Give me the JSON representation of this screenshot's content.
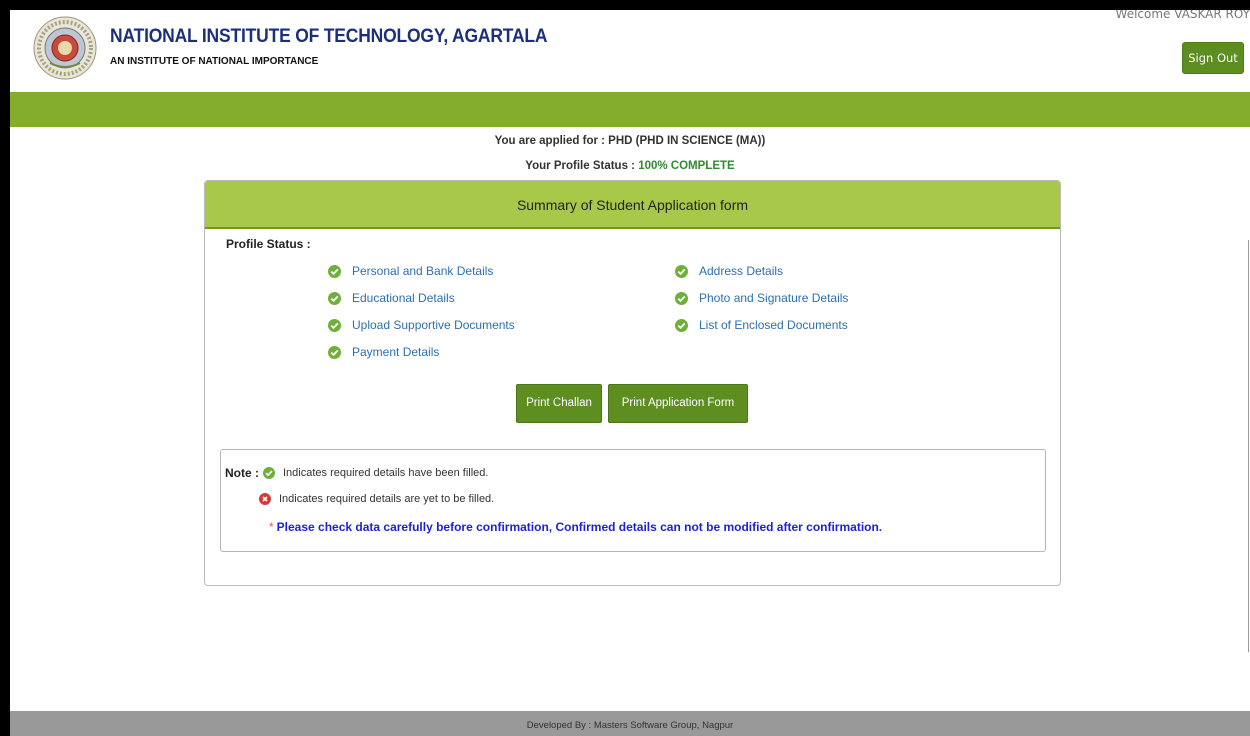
{
  "header": {
    "institute_name": "NATIONAL INSTITUTE OF TECHNOLOGY, AGARTALA",
    "institute_subtitle": "AN INSTITUTE OF NATIONAL IMPORTANCE",
    "welcome": "Welcome VASKAR ROY",
    "sign_out": "Sign Out"
  },
  "applied_for": "You are applied for : PHD (PHD IN SCIENCE (MA))",
  "profile_status": {
    "label": "Your Profile Status : ",
    "value": "100% COMPLETE"
  },
  "panel": {
    "title": "Summary of Student Application form",
    "status_label": "Profile Status :",
    "items": [
      {
        "label": "Personal and Bank Details",
        "status": "filled"
      },
      {
        "label": "Address Details",
        "status": "filled"
      },
      {
        "label": "Educational Details",
        "status": "filled"
      },
      {
        "label": "Photo and Signature Details",
        "status": "filled"
      },
      {
        "label": "Upload Supportive Documents",
        "status": "filled"
      },
      {
        "label": "List of Enclosed Documents",
        "status": "filled"
      },
      {
        "label": "Payment Details",
        "status": "filled"
      }
    ],
    "buttons": {
      "print_challan": "Print Challan",
      "print_application": "Print Application Form"
    },
    "note": {
      "label": "Note :",
      "filled_text": "Indicates required details have been filled.",
      "pending_text": "Indicates required details are yet to be filled.",
      "warning_star": "*",
      "warning": "Please check data carefully before confirmation, Confirmed details can not be modified after confirmation."
    }
  },
  "colors": {
    "brand_green": "#84ad2c",
    "button_green": "#5f8e20",
    "title_blue": "#1c2f7a",
    "link_blue": "#2f6fb0",
    "warning_blue": "#1f1fd8"
  },
  "footer": "Developed By : Masters Software Group, Nagpur"
}
